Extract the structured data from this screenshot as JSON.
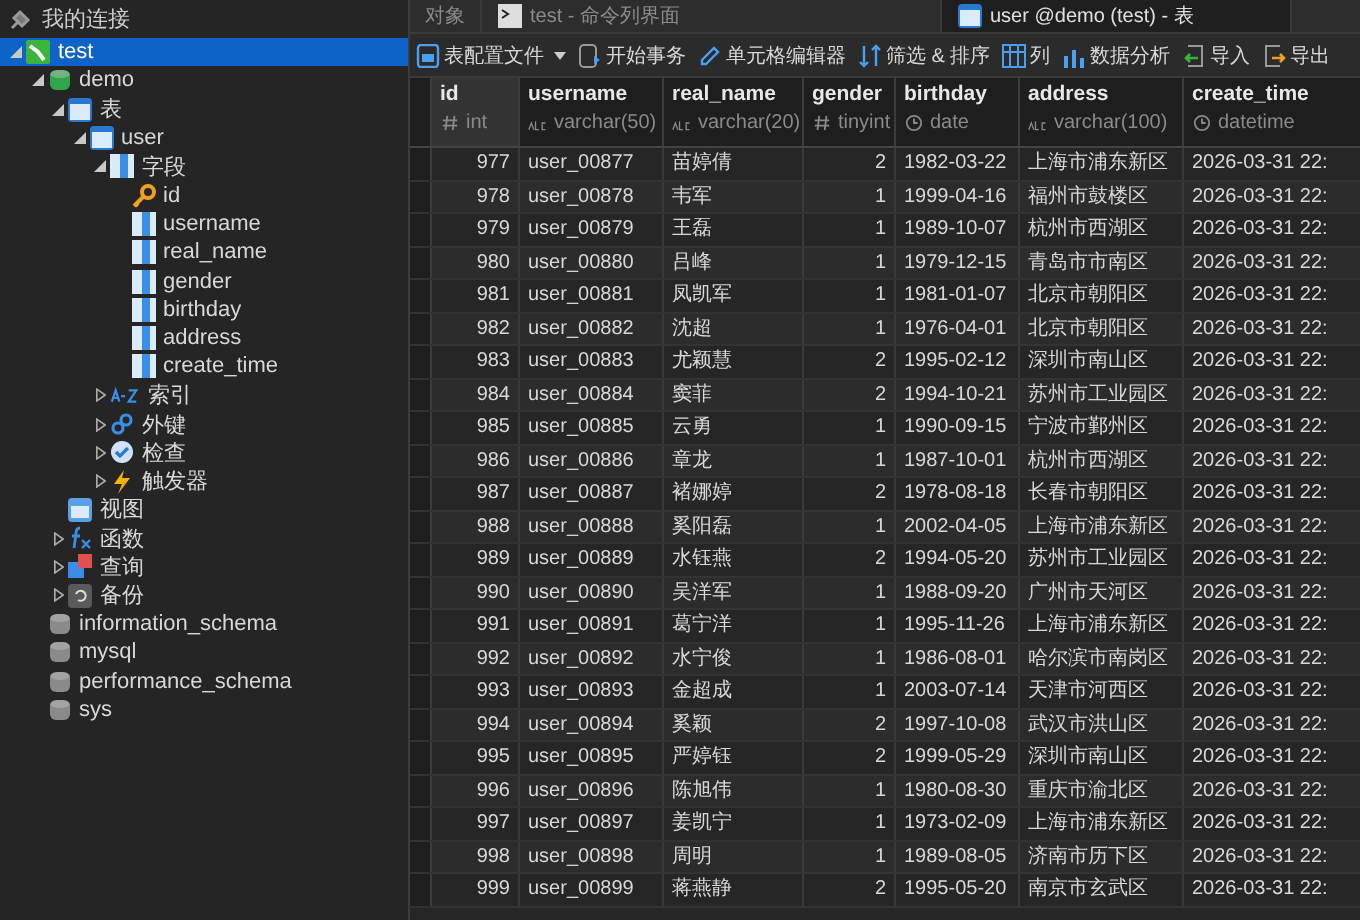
{
  "sidebar": {
    "title": "我的连接",
    "tree": [
      {
        "label": "test",
        "kind": "connection",
        "expanded": true,
        "selected": true,
        "children": [
          {
            "label": "demo",
            "kind": "database",
            "expanded": true,
            "selected": false,
            "children": [
              {
                "label": "表",
                "kind": "table-group",
                "expanded": true,
                "selected": false,
                "children": [
                  {
                    "label": "user",
                    "kind": "table",
                    "expanded": true,
                    "selected": false,
                    "children": [
                      {
                        "label": "字段",
                        "kind": "fields",
                        "expanded": true,
                        "selected": false,
                        "children": [
                          {
                            "label": "id",
                            "kind": "key",
                            "selected": false
                          },
                          {
                            "label": "username",
                            "kind": "column",
                            "selected": false
                          },
                          {
                            "label": "real_name",
                            "kind": "column",
                            "selected": false
                          },
                          {
                            "label": "gender",
                            "kind": "column",
                            "selected": false
                          },
                          {
                            "label": "birthday",
                            "kind": "column",
                            "selected": false
                          },
                          {
                            "label": "address",
                            "kind": "column",
                            "selected": false
                          },
                          {
                            "label": "create_time",
                            "kind": "column",
                            "selected": false
                          }
                        ]
                      },
                      {
                        "label": "索引",
                        "kind": "index",
                        "expanded": false,
                        "selected": false
                      },
                      {
                        "label": "外键",
                        "kind": "foreign-key",
                        "expanded": false,
                        "selected": false
                      },
                      {
                        "label": "检查",
                        "kind": "check",
                        "expanded": false,
                        "selected": false
                      },
                      {
                        "label": "触发器",
                        "kind": "trigger",
                        "expanded": false,
                        "selected": false
                      }
                    ]
                  }
                ]
              },
              {
                "label": "视图",
                "kind": "view",
                "selected": false
              },
              {
                "label": "函数",
                "kind": "function",
                "expanded": false,
                "selected": false
              },
              {
                "label": "查询",
                "kind": "query",
                "expanded": false,
                "selected": false
              },
              {
                "label": "备份",
                "kind": "backup",
                "expanded": false,
                "selected": false
              }
            ]
          },
          {
            "label": "information_schema",
            "kind": "database-closed",
            "selected": false
          },
          {
            "label": "mysql",
            "kind": "database-closed",
            "selected": false
          },
          {
            "label": "performance_schema",
            "kind": "database-closed",
            "selected": false
          },
          {
            "label": "sys",
            "kind": "database-closed",
            "selected": false
          }
        ]
      }
    ]
  },
  "tabs": [
    {
      "label": "对象",
      "kind": "plain",
      "selected": false
    },
    {
      "label": "test - 命令列界面",
      "kind": "console",
      "selected": false
    },
    {
      "label": "user @demo (test) - 表",
      "kind": "table",
      "selected": true
    }
  ],
  "toolbar": [
    {
      "label": "表配置文件",
      "kind": "profile",
      "dropdown": true
    },
    {
      "label": "开始事务",
      "kind": "transaction",
      "dropdown": false
    },
    {
      "label": "单元格编辑器",
      "kind": "editor",
      "dropdown": false
    },
    {
      "label": "筛选 & 排序",
      "kind": "filter",
      "dropdown": false
    },
    {
      "label": "列",
      "kind": "columns",
      "dropdown": false
    },
    {
      "label": "数据分析",
      "kind": "analysis",
      "dropdown": false
    },
    {
      "label": "导入",
      "kind": "import",
      "dropdown": false
    },
    {
      "label": "导出",
      "kind": "export",
      "dropdown": false
    }
  ],
  "table": {
    "columns": [
      {
        "name": "id",
        "type": "int",
        "kind": "number",
        "selected": true
      },
      {
        "name": "username",
        "type": "varchar(50)",
        "kind": "text",
        "selected": false
      },
      {
        "name": "real_name",
        "type": "varchar(20)",
        "kind": "text",
        "selected": false
      },
      {
        "name": "gender",
        "type": "tinyint",
        "kind": "number",
        "selected": false
      },
      {
        "name": "birthday",
        "type": "date",
        "kind": "time",
        "selected": false
      },
      {
        "name": "address",
        "type": "varchar(100)",
        "kind": "text",
        "selected": false
      },
      {
        "name": "create_time",
        "type": "datetime",
        "kind": "time",
        "selected": false
      }
    ],
    "rows": [
      [
        "977",
        "user_00877",
        "苗婷倩",
        "2",
        "1982-03-22",
        "上海市浦东新区",
        "2026-03-31 22:"
      ],
      [
        "978",
        "user_00878",
        "韦军",
        "1",
        "1999-04-16",
        "福州市鼓楼区",
        "2026-03-31 22:"
      ],
      [
        "979",
        "user_00879",
        "王磊",
        "1",
        "1989-10-07",
        "杭州市西湖区",
        "2026-03-31 22:"
      ],
      [
        "980",
        "user_00880",
        "吕峰",
        "1",
        "1979-12-15",
        "青岛市市南区",
        "2026-03-31 22:"
      ],
      [
        "981",
        "user_00881",
        "凤凯军",
        "1",
        "1981-01-07",
        "北京市朝阳区",
        "2026-03-31 22:"
      ],
      [
        "982",
        "user_00882",
        "沈超",
        "1",
        "1976-04-01",
        "北京市朝阳区",
        "2026-03-31 22:"
      ],
      [
        "983",
        "user_00883",
        "尤颖慧",
        "2",
        "1995-02-12",
        "深圳市南山区",
        "2026-03-31 22:"
      ],
      [
        "984",
        "user_00884",
        "窦菲",
        "2",
        "1994-10-21",
        "苏州市工业园区",
        "2026-03-31 22:"
      ],
      [
        "985",
        "user_00885",
        "云勇",
        "1",
        "1990-09-15",
        "宁波市鄞州区",
        "2026-03-31 22:"
      ],
      [
        "986",
        "user_00886",
        "章龙",
        "1",
        "1987-10-01",
        "杭州市西湖区",
        "2026-03-31 22:"
      ],
      [
        "987",
        "user_00887",
        "褚娜婷",
        "2",
        "1978-08-18",
        "长春市朝阳区",
        "2026-03-31 22:"
      ],
      [
        "988",
        "user_00888",
        "奚阳磊",
        "1",
        "2002-04-05",
        "上海市浦东新区",
        "2026-03-31 22:"
      ],
      [
        "989",
        "user_00889",
        "水钰燕",
        "2",
        "1994-05-20",
        "苏州市工业园区",
        "2026-03-31 22:"
      ],
      [
        "990",
        "user_00890",
        "吴洋军",
        "1",
        "1988-09-20",
        "广州市天河区",
        "2026-03-31 22:"
      ],
      [
        "991",
        "user_00891",
        "葛宁洋",
        "1",
        "1995-11-26",
        "上海市浦东新区",
        "2026-03-31 22:"
      ],
      [
        "992",
        "user_00892",
        "水宁俊",
        "1",
        "1986-08-01",
        "哈尔滨市南岗区",
        "2026-03-31 22:"
      ],
      [
        "993",
        "user_00893",
        "金超成",
        "1",
        "2003-07-14",
        "天津市河西区",
        "2026-03-31 22:"
      ],
      [
        "994",
        "user_00894",
        "奚颖",
        "2",
        "1997-10-08",
        "武汉市洪山区",
        "2026-03-31 22:"
      ],
      [
        "995",
        "user_00895",
        "严婷钰",
        "2",
        "1999-05-29",
        "深圳市南山区",
        "2026-03-31 22:"
      ],
      [
        "996",
        "user_00896",
        "陈旭伟",
        "1",
        "1980-08-30",
        "重庆市渝北区",
        "2026-03-31 22:"
      ],
      [
        "997",
        "user_00897",
        "姜凯宁",
        "1",
        "1973-02-09",
        "上海市浦东新区",
        "2026-03-31 22:"
      ],
      [
        "998",
        "user_00898",
        "周明",
        "1",
        "1989-08-05",
        "济南市历下区",
        "2026-03-31 22:"
      ],
      [
        "999",
        "user_00899",
        "蒋燕静",
        "2",
        "1995-05-20",
        "南京市玄武区",
        "2026-03-31 22:"
      ]
    ]
  }
}
